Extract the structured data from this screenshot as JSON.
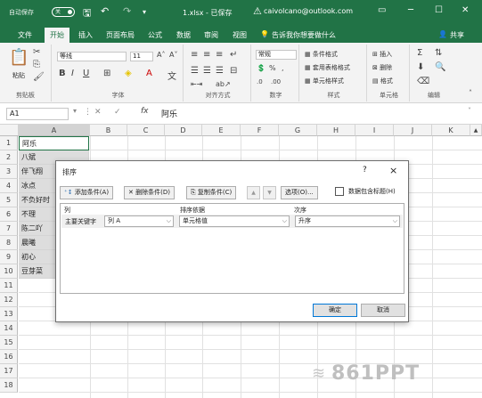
{
  "titlebar": {
    "autosave": "自动保存",
    "toggle": "关",
    "filename": "1.xlsx - 已保存",
    "user": "caivolcano@outlook.com"
  },
  "menu": {
    "tabs": [
      "文件",
      "开始",
      "插入",
      "页面布局",
      "公式",
      "数据",
      "审阅",
      "视图"
    ],
    "active_tab": "开始",
    "search": "告诉我你想要做什么",
    "share": "共享"
  },
  "ribbon": {
    "paste": "粘贴",
    "clipboard": "剪贴板",
    "font_name": "等线",
    "font_size": "11",
    "font_group": "字体",
    "align_group": "对齐方式",
    "number_format": "常规",
    "number_group": "数字",
    "cond_format": "条件格式",
    "table_format": "套用表格格式",
    "cell_style": "单元格样式",
    "styles_group": "样式",
    "insert": "插入",
    "delete": "删除",
    "format": "格式",
    "cells_group": "单元格",
    "edit_group": "编辑"
  },
  "formula_bar": {
    "name_box": "A1",
    "fx": "fx",
    "value": "阿乐"
  },
  "sheet": {
    "columns": [
      "A",
      "B",
      "C",
      "D",
      "E",
      "F",
      "G",
      "H",
      "I",
      "J",
      "K"
    ],
    "rows": [
      "1",
      "2",
      "3",
      "4",
      "5",
      "6",
      "7",
      "8",
      "9",
      "10",
      "11",
      "12",
      "13",
      "14",
      "15",
      "16",
      "17",
      "18"
    ],
    "col_a_values": [
      "阿乐",
      "八斌",
      "伴飞翔",
      "冰点",
      "不负好时",
      "不理",
      "陈二吖",
      "晨曦",
      "初心",
      "豆芽菜"
    ]
  },
  "dialog": {
    "title": "排序",
    "help": "?",
    "close": "×",
    "add_level": "添加条件(A)",
    "delete_level": "删除条件(D)",
    "copy_level": "复制条件(C)",
    "options": "选项(O)...",
    "header_checkbox": "数据包含标题(H)",
    "col_header": "列",
    "sort_on_header": "排序依据",
    "order_header": "次序",
    "row_label": "主要关键字",
    "column_value": "列 A",
    "sort_on_value": "单元格值",
    "order_value": "升序",
    "ok": "确定",
    "cancel": "取消"
  },
  "watermark": "861PPT"
}
